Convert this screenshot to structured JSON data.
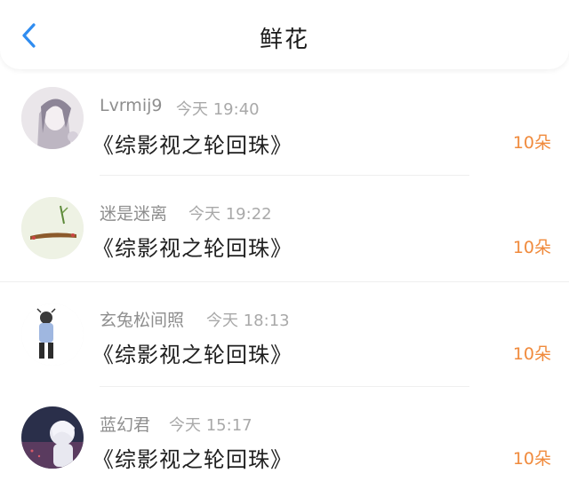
{
  "header": {
    "title": "鲜花"
  },
  "items": [
    {
      "name": "Lvrmij9",
      "time": "今天 19:40",
      "book": "《综影视之轮回珠》",
      "count": "10朵"
    },
    {
      "name": "迷是迷离",
      "time": "今天 19:22",
      "book": "《综影视之轮回珠》",
      "count": "10朵"
    },
    {
      "name": "玄兔松间照",
      "time": "今天 18:13",
      "book": "《综影视之轮回珠》",
      "count": "10朵"
    },
    {
      "name": "蓝幻君",
      "time": "今天 15:17",
      "book": "《综影视之轮回珠》",
      "count": "10朵"
    }
  ],
  "colors": {
    "accent_back": "#2f8cf0",
    "count": "#f08a3c"
  },
  "icons": {
    "back": "chevron-left-icon"
  }
}
